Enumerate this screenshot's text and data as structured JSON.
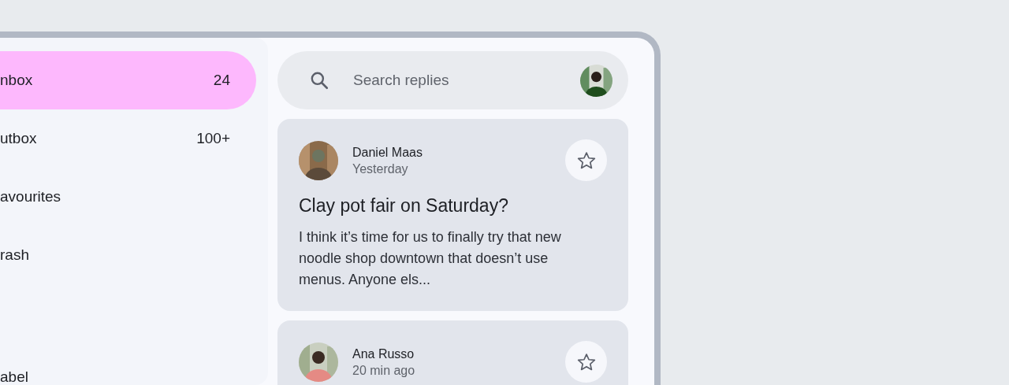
{
  "nav": {
    "items": [
      {
        "label": "nbox",
        "count": "24",
        "selected": true
      },
      {
        "label": "utbox",
        "count": "100+",
        "selected": false
      },
      {
        "label": "avourites",
        "selected": false
      },
      {
        "label": "rash",
        "selected": false
      }
    ],
    "section_items": [
      {
        "label": "abel"
      }
    ]
  },
  "search": {
    "placeholder": "Search replies"
  },
  "emails": [
    {
      "sender": "Daniel Maas",
      "time": "Yesterday",
      "subject": "Clay pot fair on Saturday?",
      "preview": "I think it’s time for us to finally try that new noodle shop downtown that doesn’t use menus. Anyone els...",
      "starred": false
    },
    {
      "sender": "Ana Russo",
      "time": "20 min ago",
      "starred": false
    }
  ]
}
